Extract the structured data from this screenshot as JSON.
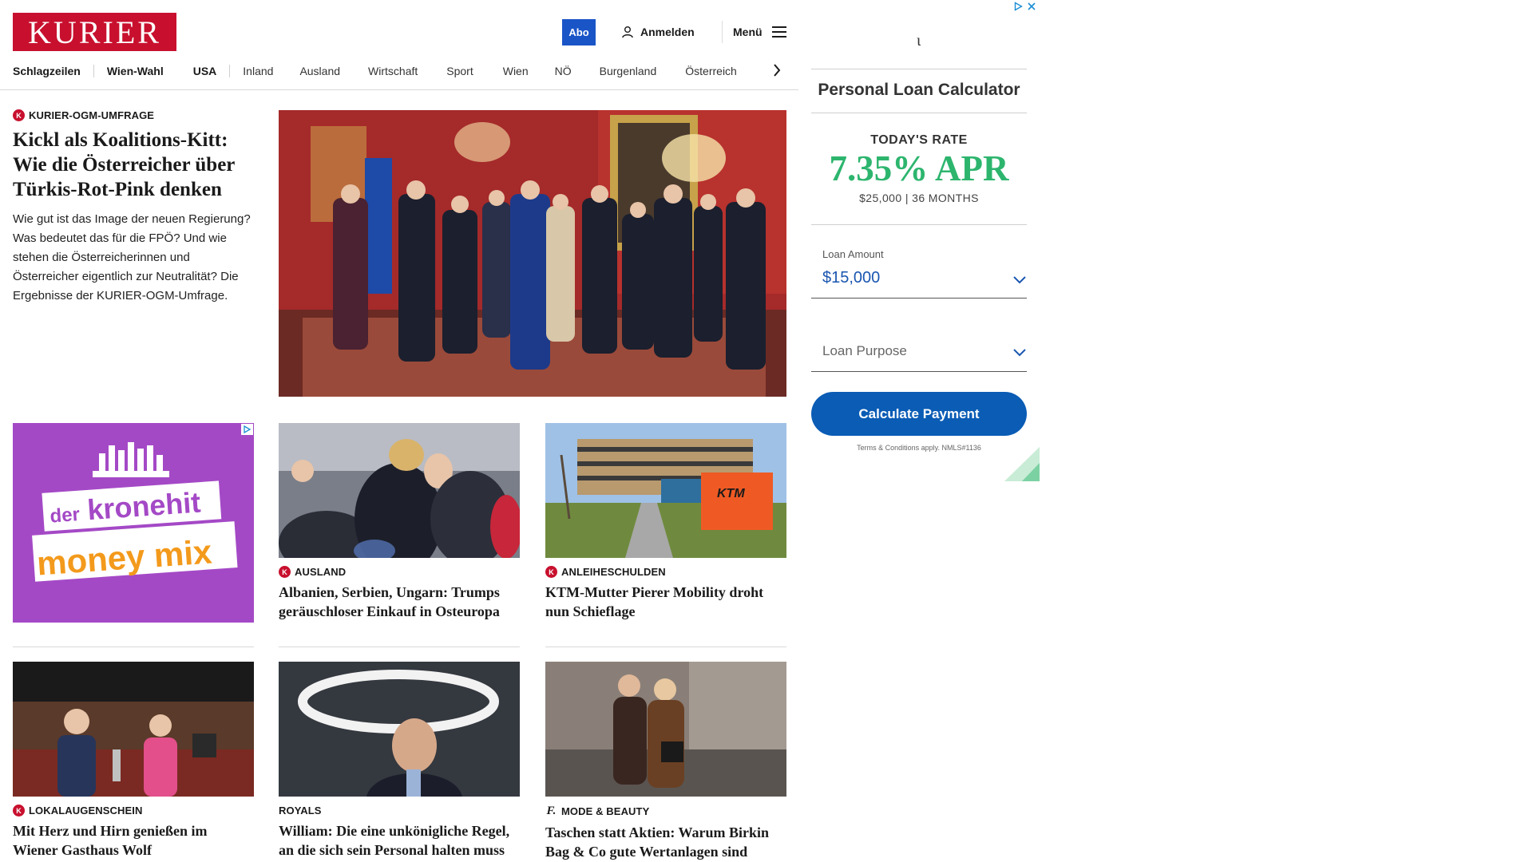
{
  "header": {
    "logo": "KURIER",
    "abo": "Abo",
    "login": "Anmelden",
    "menu": "Menü"
  },
  "nav": {
    "items": [
      "Schlagzeilen",
      "Wien-Wahl",
      "USA",
      "Inland",
      "Ausland",
      "Wirtschaft",
      "Sport",
      "Wien",
      "NÖ",
      "Burgenland",
      "Österreich"
    ]
  },
  "lead": {
    "kicker": "KURIER-OGM-UMFRAGE",
    "headline": "Kickl als Koalitions-Kitt: Wie die Österreicher über Türkis-Rot-Pink denken",
    "teaser": "Wie gut ist das Image der neuen Regierung? Was bedeutet das für die FPÖ? Und wie stehen die Österreicherinnen und Österreicher eigentlich zur Neutralität? Die Ergebnisse der KURIER-OGM-Umfrage."
  },
  "ad_tile": {
    "line1": "der",
    "line2": "kronehit",
    "line3": "money mix"
  },
  "cards": [
    {
      "kicker": "AUSLAND",
      "headline": "Albanien, Serbien, Ungarn: Trumps geräuschloser Einkauf in Osteuropa"
    },
    {
      "kicker": "ANLEIHESCHULDEN",
      "headline": "KTM-Mutter Pierer Mobility droht nun Schieflage",
      "sign": "KTM"
    },
    {
      "kicker": "LOKALAUGENSCHEIN",
      "headline": "Mit Herz und Hirn genießen im Wiener Gasthaus Wolf"
    },
    {
      "kicker": "ROYALS",
      "headline": "William: Die eine unkönigliche Regel, an die sich sein Personal halten muss"
    },
    {
      "kicker": "MODE & BEAUTY",
      "headline": "Taschen statt Aktien: Warum Birkin Bag & Co gute Wertanlagen sind"
    }
  ],
  "badges": {
    "k": "K",
    "f": "f."
  },
  "ad": {
    "title": "Personal Loan Calculator",
    "rate_label": "TODAY'S RATE",
    "rate_value": "7.35% APR",
    "rate_sub": "$25,000 | 36 MONTHS",
    "amount_label": "Loan Amount",
    "amount_value": "$15,000",
    "purpose_placeholder": "Loan Purpose",
    "button": "Calculate Payment",
    "terms": "Terms & Conditions apply. NMLS#1136"
  },
  "colors": {
    "brand_red": "#c8102e",
    "abo_blue": "#1a55c8",
    "ad_green": "#2db56e",
    "ad_button_blue": "#0a5cb5",
    "kronehit_purple": "#a449c6"
  }
}
